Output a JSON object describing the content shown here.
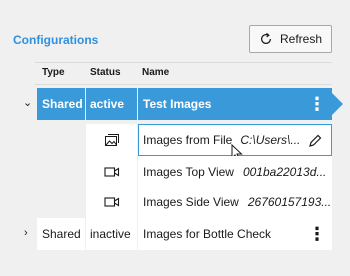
{
  "panel": {
    "title": "Configurations"
  },
  "toolbar": {
    "refresh_label": "Refresh",
    "refresh_icon": "refresh-icon"
  },
  "table": {
    "headers": {
      "type": "Type",
      "status": "Status",
      "name": "Name"
    },
    "rows": [
      {
        "type": "Shared",
        "status": "active",
        "name": "Test Images",
        "expanded": true,
        "selected": true
      },
      {
        "type": "Shared",
        "status": "inactive",
        "name": "Images for Bottle Check",
        "expanded": false,
        "selected": false
      }
    ],
    "subrows": [
      {
        "icon": "image-file-icon",
        "name": "Images from File",
        "value": "C:\\Users\\..."
      },
      {
        "icon": "camera-icon",
        "name": "Images Top View",
        "value": "001ba22013d..."
      },
      {
        "icon": "camera-icon",
        "name": "Images Side View",
        "value": "26760157193..."
      }
    ]
  },
  "colors": {
    "accent": "#3a9ad9",
    "title": "#2e90e0",
    "background": "#f0f0f0"
  }
}
